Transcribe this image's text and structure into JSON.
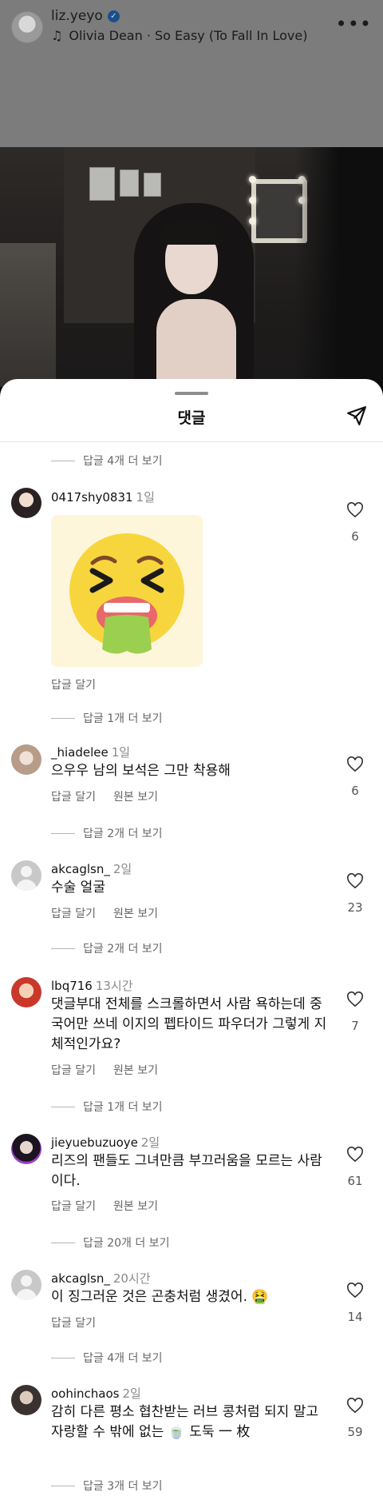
{
  "header": {
    "username": "liz.yeyo",
    "song": "Olivia Dean · So Easy (To Fall In Love)",
    "more_icon": "more-horizontal-icon",
    "music_icon": "music-note-icon"
  },
  "sheet": {
    "title": "댓글",
    "share_icon": "send-icon"
  },
  "labels": {
    "reply": "답글 달기",
    "see_original": "원본 보기"
  },
  "view_more": [
    "답글 4개 더 보기",
    "답글 1개 더 보기",
    "답글 2개 더 보기",
    "답글 2개 더 보기",
    "답글 1개 더 보기",
    "답글 20개 더 보기",
    "답글 4개 더 보기",
    "답글 3개 더 보기"
  ],
  "comments": [
    {
      "user": "0417shy0831",
      "time": "1일",
      "text": "",
      "likes": "6"
    },
    {
      "user": "_hiadelee",
      "time": "1일",
      "text": "으우우 남의 보석은 그만 착용해",
      "likes": "6"
    },
    {
      "user": "akcaglsn_",
      "time": "2일",
      "text": "수술 얼굴",
      "likes": "23"
    },
    {
      "user": "lbq716",
      "time": "13시간",
      "text": "댓글부대 전체를 스크롤하면서 사람 욕하는데 중국어만 쓰네 이지의 펩타이드 파우더가 그렇게 지체적인가요?",
      "likes": "7"
    },
    {
      "user": "jieyuebuzuoye",
      "time": "2일",
      "text": "리즈의 팬들도 그녀만큼 부끄러움을 모르는 사람이다.",
      "likes": "61"
    },
    {
      "user": "akcaglsn_",
      "time": "20시간",
      "text": "이 징그러운 것은 곤충처럼 생겼어. 🤮",
      "likes": "14"
    },
    {
      "user": "oohinchaos",
      "time": "2일",
      "text": "감히 다른 평소 협찬받는 러브 콩처럼 되지 말고 자랑할 수 밖에 없는 🍵 도둑 一 枚",
      "likes": "59"
    }
  ]
}
